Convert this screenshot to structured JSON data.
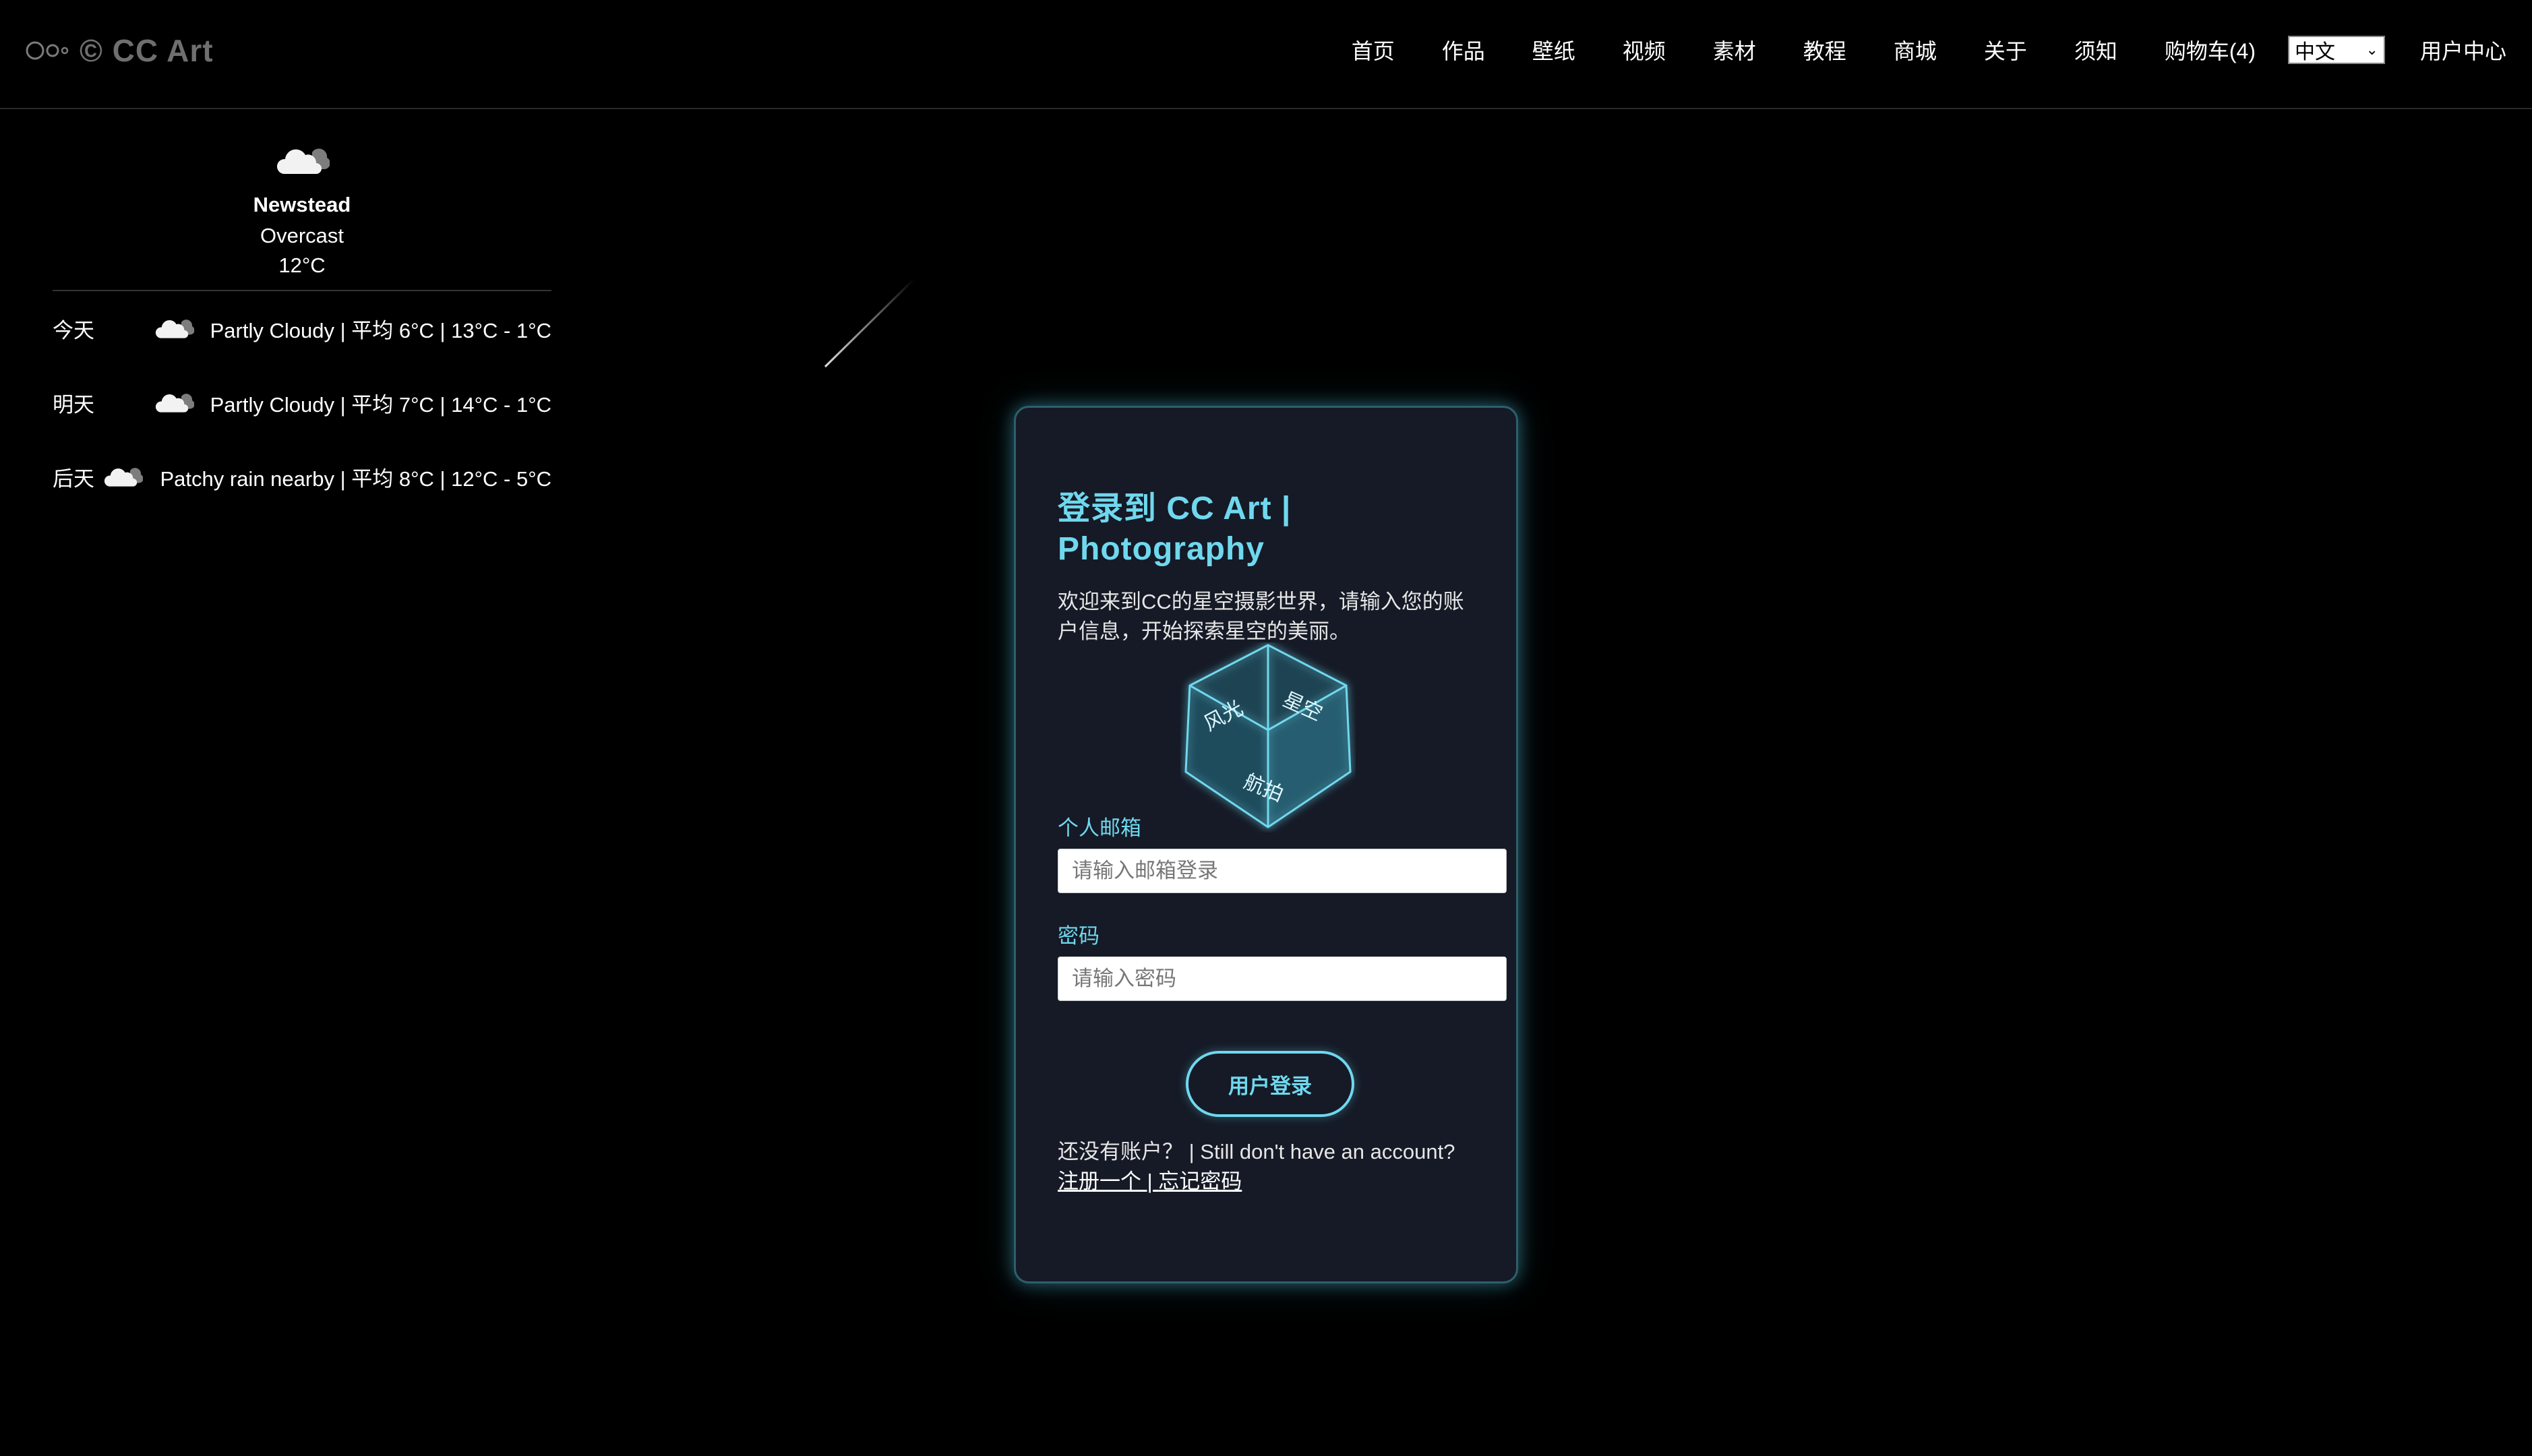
{
  "header": {
    "logo_text": "© CC Art",
    "nav": [
      "首页",
      "作品",
      "壁纸",
      "视频",
      "素材",
      "教程",
      "商城",
      "关于",
      "须知",
      "购物车(4)"
    ],
    "language": "中文",
    "user_center": "用户中心"
  },
  "weather": {
    "city": "Newstead",
    "condition": "Overcast",
    "temperature": "12°C",
    "forecast": [
      {
        "day": "今天",
        "summary": "Partly Cloudy | 平均 6°C | 13°C - 1°C",
        "icon": "cloud-icon"
      },
      {
        "day": "明天",
        "summary": "Partly Cloudy | 平均 7°C | 14°C - 1°C",
        "icon": "cloud-icon"
      },
      {
        "day": "后天",
        "summary": "Patchy rain nearby | 平均 8°C | 12°C - 5°C",
        "icon": "cloud-icon"
      }
    ]
  },
  "login": {
    "title": "登录到 CC Art | Photography",
    "description": "欢迎来到CC的星空摄影世界，请输入您的账户信息，开始探索星空的美丽。",
    "cube_faces": [
      "风光",
      "星空",
      "航拍"
    ],
    "email_label": "个人邮箱",
    "email_placeholder": "请输入邮箱登录",
    "password_label": "密码",
    "password_placeholder": "请输入密码",
    "submit_label": "用户登录",
    "no_account_text": "还没有账户？ | Still don't have an account?",
    "register_link": "注册一个",
    "separator": " | ",
    "forgot_link": "忘记密码"
  },
  "colors": {
    "accent": "#6fd8ee",
    "card_background": "#151a26",
    "page_background": "#000000",
    "logo_gray": "#6f6f6f"
  }
}
